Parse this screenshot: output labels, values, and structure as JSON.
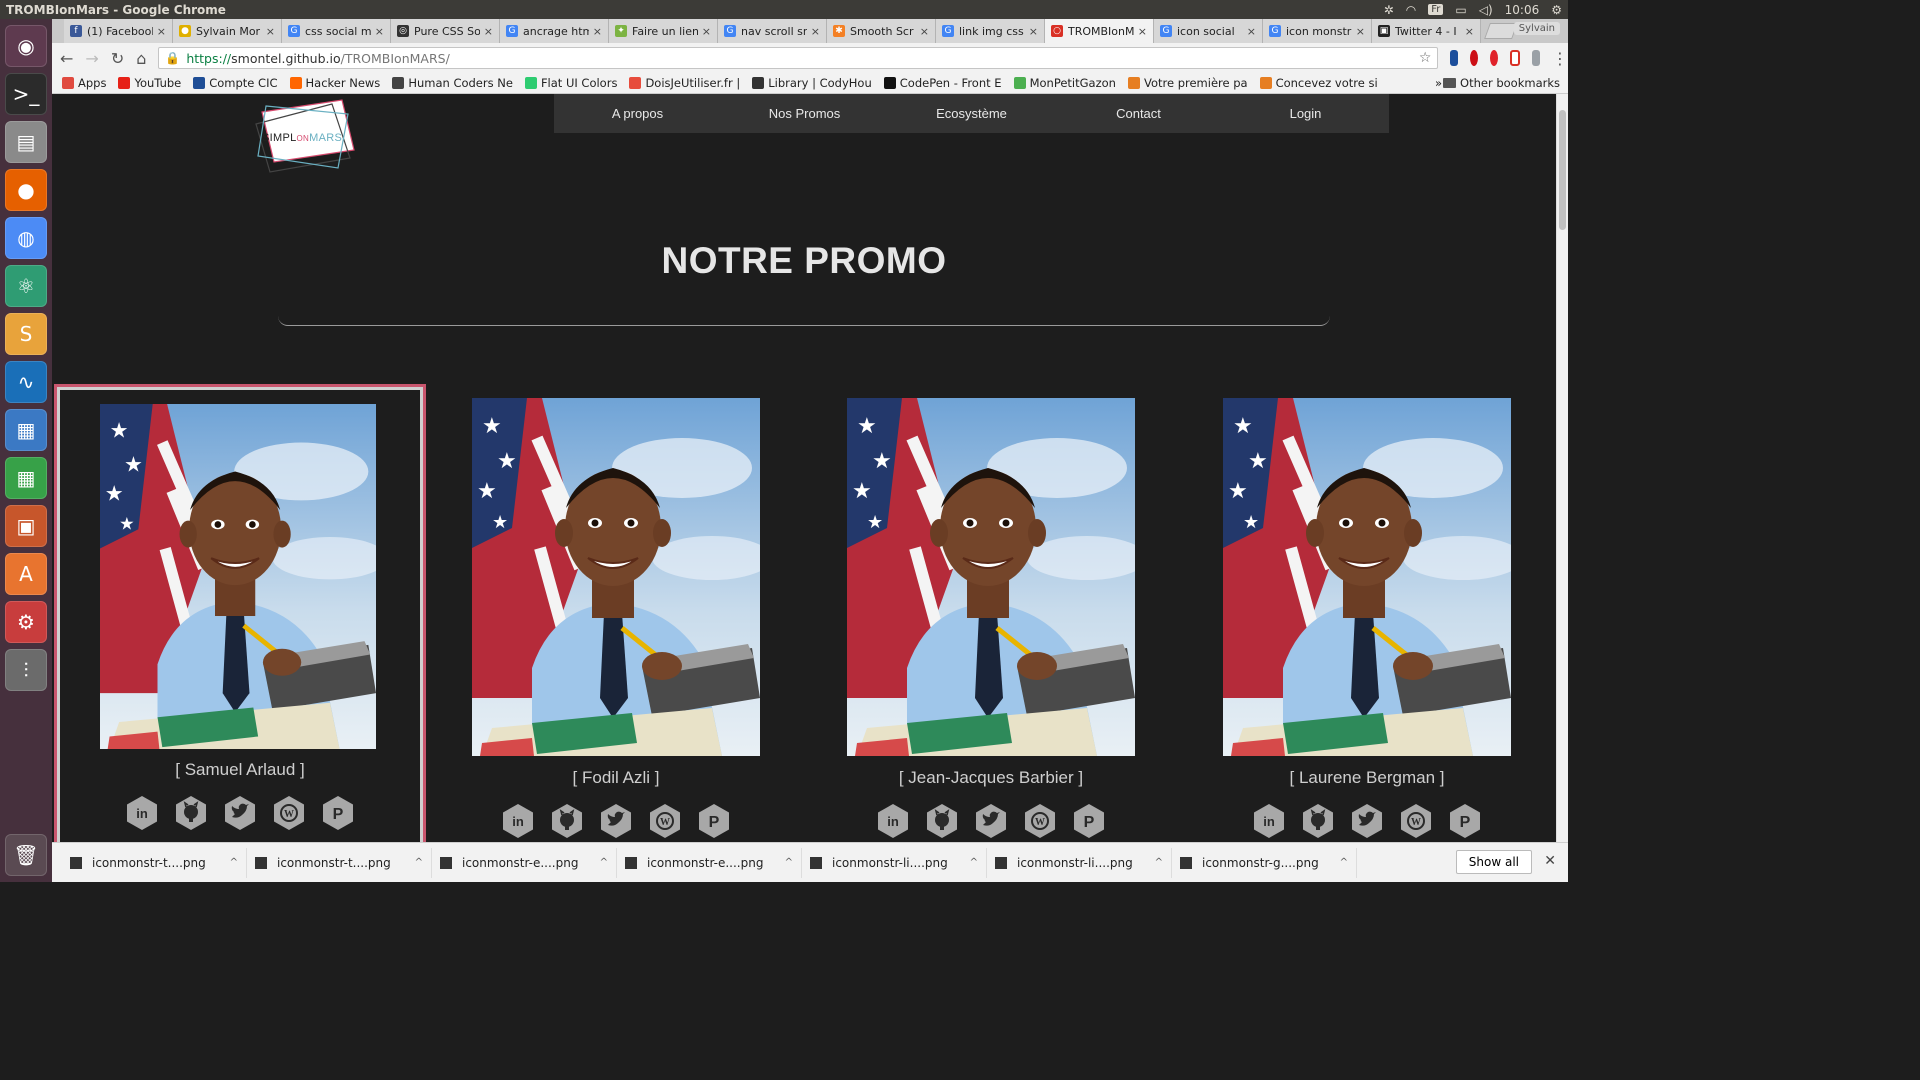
{
  "os": {
    "window_title": "TROMBIonMars - Google Chrome",
    "tray": {
      "keyboard": "Fr",
      "time": "10:06"
    }
  },
  "browser": {
    "user": "Sylvain",
    "tabs": [
      {
        "label": "(1) Facebook",
        "fav_color": "#3b5998",
        "fav_char": "f"
      },
      {
        "label": "Sylvain Mor",
        "fav_color": "#e0b000",
        "fav_char": "●"
      },
      {
        "label": "css social m",
        "fav_color": "#4285f4",
        "fav_char": "G"
      },
      {
        "label": "Pure CSS So",
        "fav_color": "#333333",
        "fav_char": "◎"
      },
      {
        "label": "ancrage htm",
        "fav_color": "#4285f4",
        "fav_char": "G"
      },
      {
        "label": "Faire un lien",
        "fav_color": "#7cb342",
        "fav_char": "✦"
      },
      {
        "label": "nav scroll sr",
        "fav_color": "#4285f4",
        "fav_char": "G"
      },
      {
        "label": "Smooth Scr",
        "fav_color": "#f48024",
        "fav_char": "✱"
      },
      {
        "label": "link img css",
        "fav_color": "#4285f4",
        "fav_char": "G"
      },
      {
        "label": "TROMBIonM",
        "fav_color": "#d93025",
        "fav_char": "○",
        "active": true
      },
      {
        "label": "icon social ",
        "fav_color": "#4285f4",
        "fav_char": "G"
      },
      {
        "label": "icon monstr",
        "fav_color": "#4285f4",
        "fav_char": "G"
      },
      {
        "label": "Twitter 4 - I",
        "fav_color": "#222222",
        "fav_char": "▣"
      }
    ],
    "url_scheme": "https://",
    "url_host": "smontel.github.io",
    "url_path": "/TROMBIonMARS/",
    "bookmarks": [
      {
        "label": "Apps",
        "color": "#e04a3f"
      },
      {
        "label": "YouTube",
        "color": "#e62117"
      },
      {
        "label": "Compte CIC",
        "color": "#1f4e96"
      },
      {
        "label": "Hacker News",
        "color": "#ff6600"
      },
      {
        "label": "Human Coders Ne",
        "color": "#444444"
      },
      {
        "label": "Flat UI Colors",
        "color": "#2ecc71"
      },
      {
        "label": "DoisJeUtiliser.fr |",
        "color": "#e74c3c"
      },
      {
        "label": "Library | CodyHou",
        "color": "#333333"
      },
      {
        "label": "CodePen - Front E",
        "color": "#111111"
      },
      {
        "label": "MonPetitGazon",
        "color": "#4caf50"
      },
      {
        "label": "Votre première pa",
        "color": "#e67e22"
      },
      {
        "label": "Concevez votre si",
        "color": "#e67e22"
      }
    ],
    "other_bookmarks": "Other bookmarks",
    "chevron": "»"
  },
  "site": {
    "logo": {
      "simpl": "SIMPL",
      "on": "ON",
      "mars": "MARS"
    },
    "nav": [
      "A propos",
      "Nos Promos",
      "Ecosystème",
      "Contact",
      "Login"
    ],
    "section_title": "NOTRE PROMO",
    "members": [
      {
        "name": "[ Samuel Arlaud ]"
      },
      {
        "name": "[ Fodil Azli ]"
      },
      {
        "name": "[ Jean-Jacques Barbier ]"
      },
      {
        "name": "[ Laurene Bergman ]"
      }
    ],
    "social_icons": [
      "linkedin-icon",
      "github-icon",
      "twitter-icon",
      "wordpress-icon",
      "pinterest-icon"
    ],
    "social_glyphs": [
      "in",
      "",
      "",
      "W",
      "P"
    ]
  },
  "downloads": {
    "items": [
      "iconmonstr-t....png",
      "iconmonstr-t....png",
      "iconmonstr-e....png",
      "iconmonstr-e....png",
      "iconmonstr-li....png",
      "iconmonstr-li....png",
      "iconmonstr-g....png"
    ],
    "show_all": "Show all"
  }
}
